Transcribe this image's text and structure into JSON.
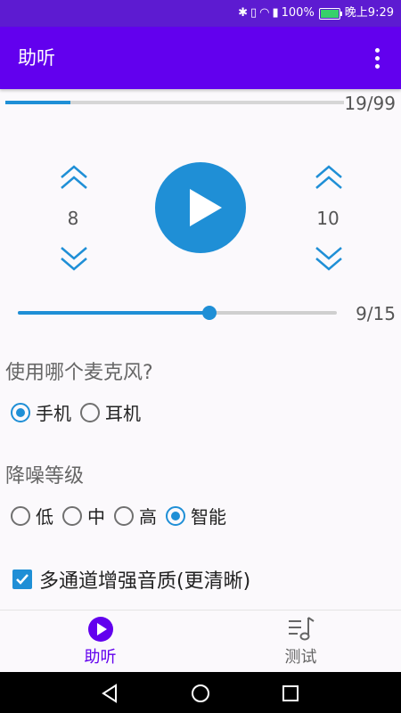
{
  "status_bar": {
    "battery_percent": "100%",
    "time": "晚上9:29"
  },
  "app_bar": {
    "title": "助听"
  },
  "progress": {
    "text": "19/99",
    "value": 19,
    "max": 99
  },
  "controls": {
    "left_value": "8",
    "right_value": "10"
  },
  "volume_slider": {
    "text": "9/15",
    "value": 9,
    "max": 15
  },
  "mic_section": {
    "title": "使用哪个麦克风?",
    "options": [
      {
        "label": "手机",
        "checked": true
      },
      {
        "label": "耳机",
        "checked": false
      }
    ]
  },
  "noise_section": {
    "title": "降噪等级",
    "options": [
      {
        "label": "低",
        "checked": false
      },
      {
        "label": "中",
        "checked": false
      },
      {
        "label": "高",
        "checked": false
      },
      {
        "label": "智能",
        "checked": true
      }
    ]
  },
  "multichannel": {
    "label": "多通道增强音质(更清晰)",
    "checked": true
  },
  "bottom_nav": {
    "items": [
      {
        "label": "助听",
        "active": true
      },
      {
        "label": "测试",
        "active": false
      }
    ]
  },
  "colors": {
    "primary": "#6200ee",
    "accent": "#1f8fd6",
    "inactive": "#666666"
  }
}
